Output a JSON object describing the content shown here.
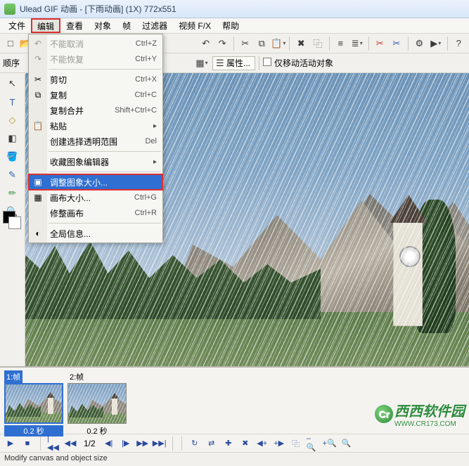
{
  "title": "Ulead GIF 动画 - [下雨动画] (1X) 772x551",
  "menubar": [
    "文件",
    "编辑",
    "查看",
    "对象",
    "帧",
    "过滤器",
    "视频 F/X",
    "帮助"
  ],
  "menubar_open_index": 1,
  "dropdown": {
    "items": [
      {
        "icon": "undo-icon",
        "glyph": "↶",
        "label": "不能取消",
        "shortcut": "Ctrl+Z",
        "disabled": true
      },
      {
        "icon": "redo-icon",
        "glyph": "↷",
        "label": "不能恢复",
        "shortcut": "Ctrl+Y",
        "disabled": true
      },
      {
        "sep": true
      },
      {
        "icon": "cut-icon",
        "glyph": "✂",
        "label": "剪切",
        "shortcut": "Ctrl+X"
      },
      {
        "icon": "copy-icon",
        "glyph": "⧉",
        "label": "复制",
        "shortcut": "Ctrl+C"
      },
      {
        "icon": "merge-copy-icon",
        "glyph": "",
        "label": "复制合并",
        "shortcut": "Shift+Ctrl+C"
      },
      {
        "icon": "paste-icon",
        "glyph": "📋",
        "label": "粘贴",
        "shortcut": "",
        "sub": true
      },
      {
        "icon": "select-transparent-icon",
        "glyph": "",
        "label": "创建选择透明范围",
        "shortcut": "Del"
      },
      {
        "sep": true
      },
      {
        "icon": "fav-editor-icon",
        "glyph": "",
        "label": "收藏图象编辑器",
        "shortcut": "",
        "sub": true
      },
      {
        "sep": true
      },
      {
        "icon": "resize-image-icon",
        "glyph": "▣",
        "label": "调整图象大小...",
        "shortcut": "",
        "selected": true
      },
      {
        "icon": "canvas-size-icon",
        "glyph": "▦",
        "label": "画布大小...",
        "shortcut": "Ctrl+G"
      },
      {
        "icon": "trim-canvas-icon",
        "glyph": "",
        "label": "修整画布",
        "shortcut": "Ctrl+R"
      },
      {
        "sep": true
      },
      {
        "icon": "global-info-icon",
        "glyph": "◐",
        "label": "全局信息...",
        "shortcut": ""
      }
    ]
  },
  "tool_rows": {
    "row1_left": [
      {
        "name": "new-icon",
        "glyph": "□"
      },
      {
        "name": "open-icon",
        "glyph": "📂",
        "drp": true
      },
      {
        "name": "save-icon",
        "glyph": "💾"
      }
    ],
    "row1_right": [
      {
        "name": "undo-icon",
        "glyph": "↶"
      },
      {
        "name": "redo-icon",
        "glyph": "↷"
      },
      {
        "sep": true
      },
      {
        "name": "cut-icon",
        "glyph": "✂"
      },
      {
        "name": "copy-icon",
        "glyph": "⧉"
      },
      {
        "name": "paste-icon",
        "glyph": "📋",
        "drp": true
      },
      {
        "sep": true
      },
      {
        "name": "delete-icon",
        "glyph": "✖"
      },
      {
        "name": "duplicate-icon",
        "glyph": "⿻"
      },
      {
        "sep": true
      },
      {
        "name": "align-left-icon",
        "glyph": "≡"
      },
      {
        "name": "align-center-icon",
        "glyph": "≣",
        "drp": true
      },
      {
        "sep": true
      },
      {
        "name": "uncrop-icon",
        "glyph": "✂",
        "cls": "red"
      },
      {
        "name": "crop-icon",
        "glyph": "✂",
        "cls": "blue"
      },
      {
        "sep": true
      },
      {
        "name": "optimize-icon",
        "glyph": "⚙"
      },
      {
        "name": "preview-icon",
        "glyph": "▶",
        "drp": true
      },
      {
        "sep": true
      },
      {
        "name": "help-icon",
        "glyph": "?"
      }
    ],
    "row2_left": [
      {
        "text_label": "顺序"
      },
      {
        "name": "bring-front-icon",
        "glyph": "▲"
      },
      {
        "name": "send-back-icon",
        "glyph": "▼"
      }
    ],
    "row2_right": [
      {
        "name": "grid-toggle-icon",
        "glyph": "▦",
        "drp": true
      },
      {
        "props_label": "属性..."
      },
      {
        "checkbox_label": "仅移动活动对象"
      }
    ]
  },
  "side_tools": [
    {
      "name": "pointer-tool",
      "glyph": "↖",
      "cls": ""
    },
    {
      "name": "text-tool",
      "glyph": "T",
      "cls": "blue"
    },
    {
      "name": "shape-tool",
      "glyph": "◇",
      "cls": "yellow"
    },
    {
      "name": "eraser-tool",
      "glyph": "◧",
      "cls": ""
    },
    {
      "name": "bucket-tool",
      "glyph": "🪣",
      "cls": ""
    },
    {
      "name": "eyedropper-tool",
      "glyph": "✎",
      "cls": "blue"
    },
    {
      "name": "brush-tool",
      "glyph": "✏",
      "cls": "green"
    },
    {
      "name": "zoom-tool",
      "glyph": "🔍",
      "cls": "blue"
    }
  ],
  "frames": [
    {
      "label": "1:帧",
      "time": "0.2 秒",
      "selected": true
    },
    {
      "label": "2:帧",
      "time": "0.2 秒",
      "selected": false
    }
  ],
  "playbar": {
    "pos": "1/2",
    "buttons_left": [
      "▶",
      "■",
      "|◀◀",
      "◀◀",
      "◀|",
      "|▶",
      "▶▶",
      "▶▶|"
    ],
    "buttons_right": [
      {
        "name": "loop-icon",
        "glyph": "↻"
      },
      {
        "name": "reverse-icon",
        "glyph": "⇄"
      },
      {
        "name": "add-frame-icon",
        "glyph": "✚"
      },
      {
        "name": "delete-frame-icon",
        "glyph": "✖"
      },
      {
        "name": "frame-left-icon",
        "glyph": "◀+"
      },
      {
        "name": "frame-right-icon",
        "glyph": "+▶"
      },
      {
        "name": "dup-frame-icon",
        "glyph": "⿻"
      },
      {
        "name": "timeline-zoom-out",
        "glyph": "–🔍"
      },
      {
        "name": "timeline-zoom-in",
        "glyph": "+🔍"
      },
      {
        "name": "timeline-zoom-reset",
        "glyph": "🔍"
      }
    ]
  },
  "status": "Modify canvas and object size",
  "watermark": {
    "text": "西西软件园",
    "url": "WWW.CR173.COM",
    "logo": "Cr"
  }
}
